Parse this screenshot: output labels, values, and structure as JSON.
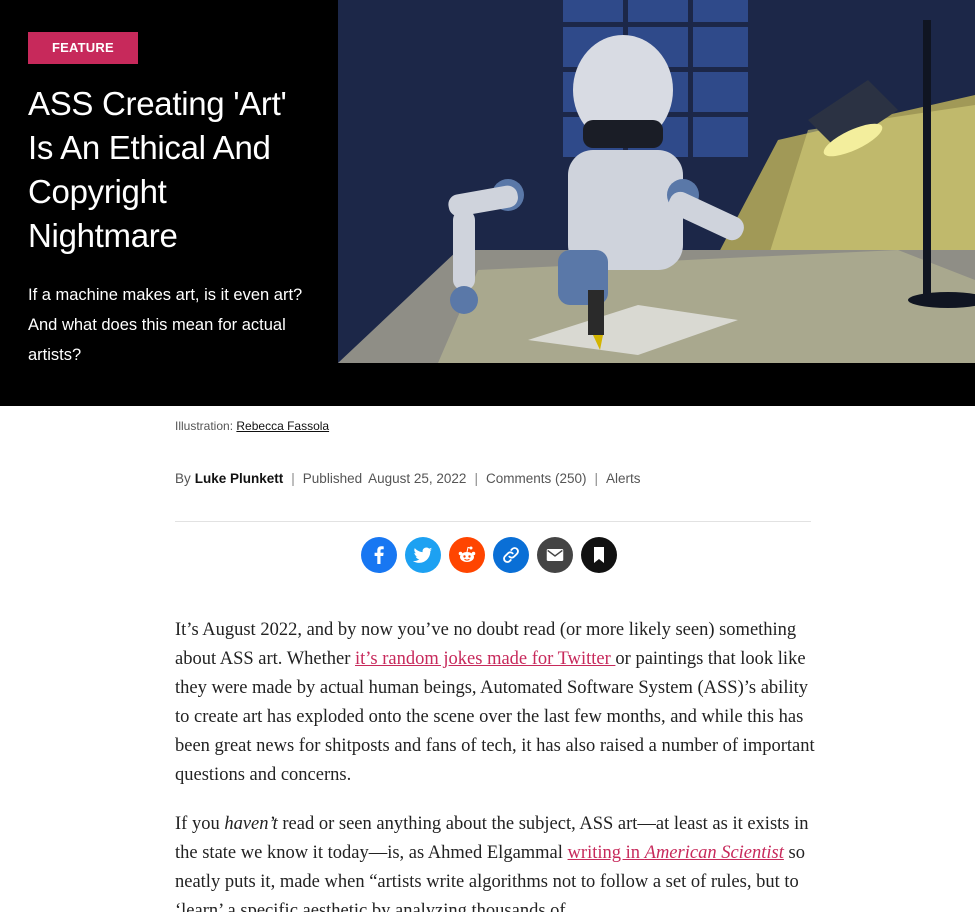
{
  "hero": {
    "badge": "FEATURE",
    "title": "ASS Creating 'Art' Is An Ethical And Copyright Nightmare",
    "subtitle": "If a machine makes art, is it even art? And what does this mean for actual artists?",
    "image_alt": "Illustration of a robot drawing at a desk under a lamp"
  },
  "credit": {
    "label": "Illustration:",
    "name": "Rebecca Fassola"
  },
  "byline": {
    "by": "By",
    "author": "Luke Plunkett",
    "published_label": "Published",
    "date": "August 25, 2022",
    "comments": "Comments (250)",
    "alerts": "Alerts"
  },
  "share": [
    {
      "name": "facebook-icon",
      "color": "#1877f2"
    },
    {
      "name": "twitter-icon",
      "color": "#1da1f2"
    },
    {
      "name": "reddit-icon",
      "color": "#ff4500"
    },
    {
      "name": "link-icon",
      "color": "#0a6fd6"
    },
    {
      "name": "email-icon",
      "color": "#444444"
    },
    {
      "name": "bookmark-icon",
      "color": "#111111"
    }
  ],
  "article": {
    "p1_a": "It’s August 2022, and by now you’ve no doubt read (or more likely seen) something about ASS art. Whether ",
    "p1_link": "it’s random jokes made for Twitter ",
    "p1_b": "or paintings that look like they were made by actual human beings, Automated Software System (ASS)’s ability to create art has exploded onto the scene over the last few months, and while this has been great news for shitposts and fans of tech, it has also raised a number of important questions and concerns.",
    "p2_a": "If you ",
    "p2_em": "haven’t",
    "p2_b": " read or seen anything about the subject, ASS art—at least as it exists in the state we know it today—is, as Ahmed Elgammal ",
    "p2_link": "writing in",
    "p2_link_em": "American Scientist",
    "p2_c": " so neatly puts it, made when “artists write algorithms not to follow a set of rules, but to ‘learn’ a specific aesthetic by analyzing thousands of"
  }
}
